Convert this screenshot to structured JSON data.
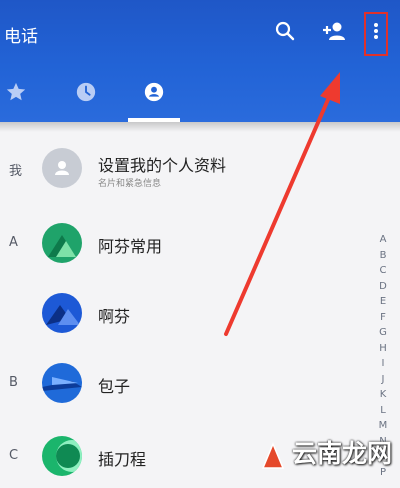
{
  "appbar": {
    "title": "电话",
    "icons": [
      "search-icon",
      "add-contact-icon",
      "more-vertical-icon"
    ]
  },
  "tabs": [
    {
      "icon": "star-icon",
      "selected": false
    },
    {
      "icon": "clock-icon",
      "selected": false
    },
    {
      "icon": "contacts-icon",
      "selected": true
    }
  ],
  "profile": {
    "section": "我",
    "name": "设置我的个人资料",
    "subtitle": "名片和紧急信息"
  },
  "contacts": [
    {
      "section": "A",
      "name": "阿芬常用",
      "avatar_color": "#1fa36a"
    },
    {
      "section": "",
      "name": "啊芬",
      "avatar_color": "#1d59d6"
    },
    {
      "section": "B",
      "name": "包子",
      "avatar_color": "#1f6ad9"
    },
    {
      "section": "C",
      "name": "插刀程",
      "avatar_color": "#1bb56c"
    }
  ],
  "alphabet": [
    "A",
    "B",
    "C",
    "D",
    "E",
    "F",
    "G",
    "H",
    "I",
    "J",
    "K",
    "L",
    "M",
    "N",
    "O",
    "P"
  ],
  "colors": {
    "primary": "#2263d6",
    "highlight": "#e0312b"
  },
  "watermark": "云南龙网"
}
